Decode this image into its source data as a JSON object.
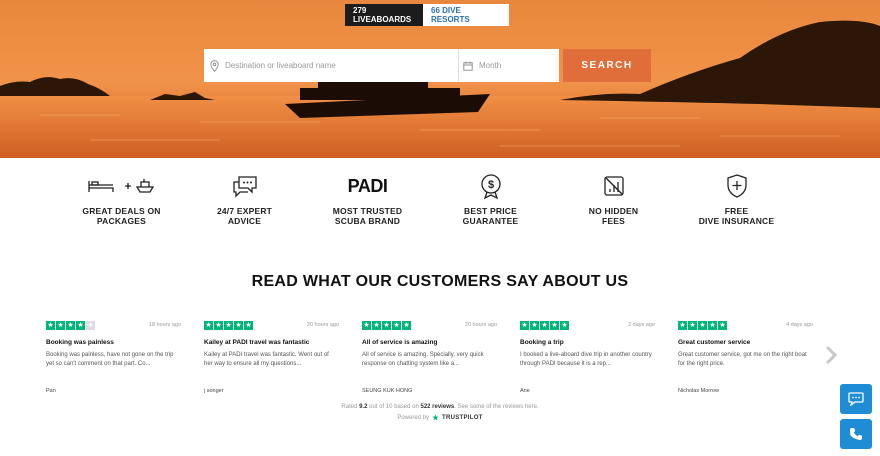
{
  "hero": {
    "tabs": [
      {
        "label": "279 LIVEABOARDS",
        "active": true
      },
      {
        "label": "66 DIVE RESORTS",
        "active": false
      }
    ],
    "search": {
      "destination_placeholder": "Destination or liveaboard name",
      "month_placeholder": "Month",
      "button_label": "SEARCH"
    }
  },
  "features": [
    {
      "icon": "bed-plus-boat-icon",
      "label_line1": "GREAT DEALS ON",
      "label_line2": "PACKAGES"
    },
    {
      "icon": "chat-bubbles-icon",
      "label_line1": "24/7 EXPERT",
      "label_line2": "ADVICE"
    },
    {
      "icon": "padi-logo",
      "logo_text": "PADI",
      "label_line1": "MOST TRUSTED",
      "label_line2": "SCUBA BRAND"
    },
    {
      "icon": "price-guarantee-icon",
      "label_line1": "BEST PRICE",
      "label_line2": "GUARANTEE"
    },
    {
      "icon": "no-fees-icon",
      "label_line1": "NO HIDDEN",
      "label_line2": "FEES"
    },
    {
      "icon": "shield-plus-icon",
      "label_line1": "FREE",
      "label_line2": "DIVE INSURANCE"
    }
  ],
  "section_title": "READ WHAT OUR CUSTOMERS SAY ABOUT US",
  "reviews": [
    {
      "stars": 4,
      "age": "18 hours ago",
      "title": "Booking was painless",
      "body": "Booking was painless, have not gone on the trip yet so can't comment on that part. Co...",
      "author": "Pan"
    },
    {
      "stars": 5,
      "age": "20 hours ago",
      "title": "Kailey at PADI travel was fantastic",
      "body": "Kailey at PADI travel was fantastic. Went out of her way to ensure all my questions...",
      "author": "j songer"
    },
    {
      "stars": 5,
      "age": "20 hours ago",
      "title": "All of service is amazing",
      "body": "All of service is amazing. Specially, very quick response on chatting system like a...",
      "author": "SEUNG KUK HONG"
    },
    {
      "stars": 5,
      "age": "2 days ago",
      "title": "Booking a trip",
      "body": "I booked a live-aboard dive trip in another country through PADI because it is a rep...",
      "author": "Ane"
    },
    {
      "stars": 5,
      "age": "4 days ago",
      "title": "Great customer service",
      "body": "Great customer service, got me on the right boat for the right price.",
      "author": "Nicholas Morrow"
    }
  ],
  "rating_summary": {
    "prefix": "Rated",
    "score": "9.2",
    "middle": "out of 10 based on",
    "count": "522 reviews",
    "suffix": ". See some of the reviews here.",
    "powered_by": "Powered by",
    "brand": "TRUSTPILOT"
  },
  "colors": {
    "accent": "#e06e3a",
    "trustpilot_green": "#00b67a",
    "fab_blue": "#1f8dd6",
    "link_blue": "#2a6fb0"
  },
  "fabs": [
    {
      "icon": "chat-icon"
    },
    {
      "icon": "phone-icon"
    }
  ]
}
